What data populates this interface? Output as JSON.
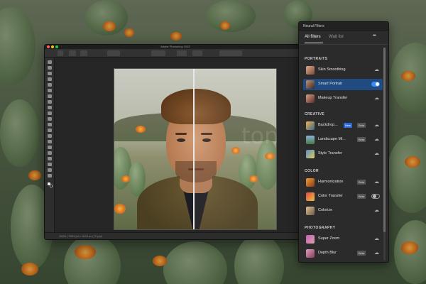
{
  "photoshop": {
    "title": "Adobe Photoshop 2022",
    "status": "100% | 1024 px x 1024 px (72 ppi)"
  },
  "watermark": "ton",
  "panel": {
    "title": "Neural Filters",
    "tabs": [
      {
        "label": "All filters",
        "active": true
      },
      {
        "label": "Wait list",
        "active": false
      }
    ],
    "more": "•••",
    "sections": [
      {
        "label": "PORTRAITS",
        "items": [
          {
            "name": "Skin Smoothing",
            "badge": "",
            "control": "cloud"
          },
          {
            "name": "Smart Portrait",
            "badge": "",
            "control": "toggle-on",
            "active": true
          },
          {
            "name": "Makeup Transfer",
            "badge": "",
            "control": "cloud"
          }
        ]
      },
      {
        "label": "CREATIVE",
        "items": [
          {
            "name": "Backdrop...",
            "badge": "New",
            "badge2": "Beta",
            "control": "cloud"
          },
          {
            "name": "Landscape Mi...",
            "badge": "Beta",
            "control": "cloud"
          },
          {
            "name": "Style Transfer",
            "badge": "",
            "control": "cloud"
          }
        ]
      },
      {
        "label": "COLOR",
        "items": [
          {
            "name": "Harmonization",
            "badge": "Beta",
            "control": "cloud"
          },
          {
            "name": "Color Transfer",
            "badge": "Beta",
            "control": "toggle-off"
          },
          {
            "name": "Colorize",
            "badge": "",
            "control": "cloud"
          }
        ]
      },
      {
        "label": "PHOTOGRAPHY",
        "items": [
          {
            "name": "Super Zoom",
            "badge": "",
            "control": "cloud"
          },
          {
            "name": "Depth Blur",
            "badge": "Beta",
            "control": "cloud"
          }
        ]
      }
    ]
  },
  "icons": {
    "cloud": "cloud-download-icon",
    "toggle": "toggle-switch"
  },
  "colors": {
    "accent": "#1f4b80",
    "toggle_on": "#3b8bf5",
    "new_badge": "#2b6ad6"
  }
}
